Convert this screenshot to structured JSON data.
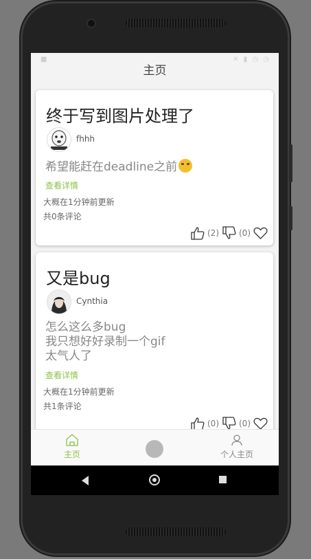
{
  "app": {
    "title": "主页"
  },
  "posts": [
    {
      "title": "终于写到图片处理了",
      "author": "fhhh",
      "body": "希望能赶在deadline之前",
      "details_label": "查看详情",
      "updated": "大概在1分钟前更新",
      "comments": "共0条评论",
      "likes": "(2)",
      "dislikes": "(0)"
    },
    {
      "title": "又是bug",
      "author": "Cynthia",
      "body": "怎么这么多bug\n我只想好好录制一个gif\n太气人了",
      "details_label": "查看详情",
      "updated": "大概在1分钟前更新",
      "comments": "共1条评论",
      "likes": "(0)",
      "dislikes": "(0)"
    }
  ],
  "nav": {
    "home_label": "主页",
    "profile_label": "个人主页"
  },
  "colors": {
    "accent": "#8bc34a",
    "title_text": "#222222",
    "body_text": "#888888"
  },
  "icons": [
    "thumbs-up-icon",
    "thumbs-down-icon",
    "heart-icon",
    "home-icon",
    "person-icon",
    "back-icon",
    "home-circle-icon",
    "recents-icon"
  ]
}
